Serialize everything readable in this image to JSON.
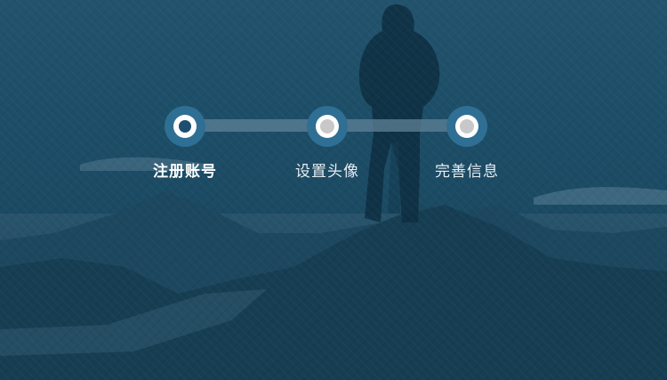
{
  "steps": [
    {
      "label": "注册账号",
      "state": "active"
    },
    {
      "label": "设置头像",
      "state": "pending"
    },
    {
      "label": "完善信息",
      "state": "pending"
    }
  ],
  "colors": {
    "accent": "#2f6f93",
    "active_core": "#1d4e70",
    "pending_core": "#c8c8c8",
    "background": "#1d4e68"
  },
  "background_image": "person-on-mountain-silhouette"
}
